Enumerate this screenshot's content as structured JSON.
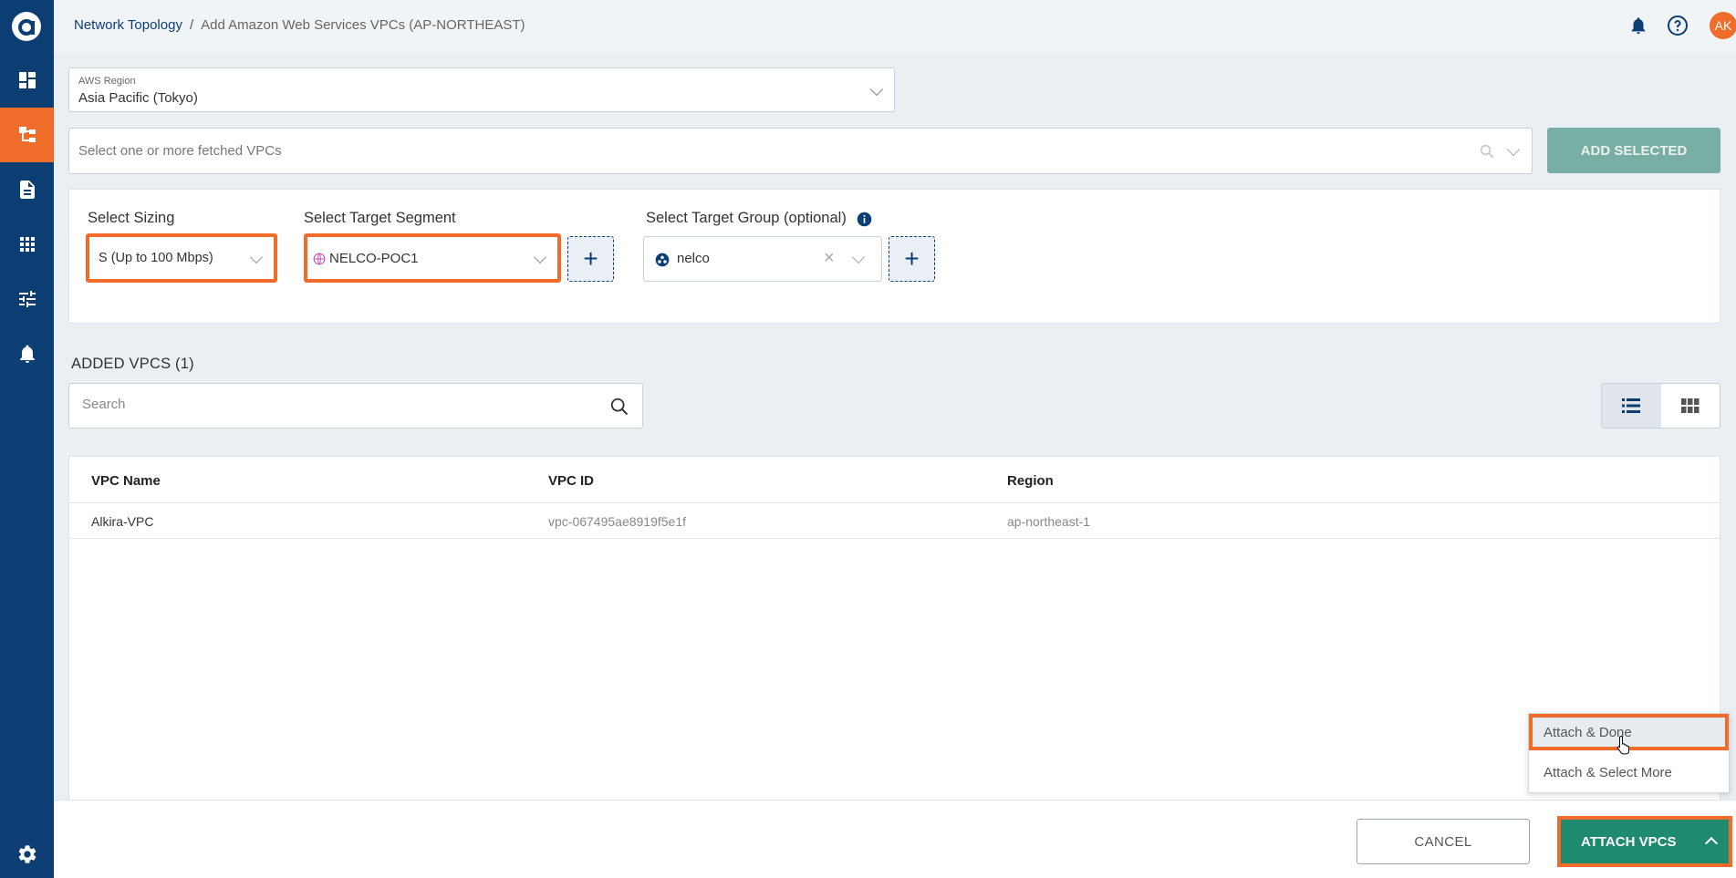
{
  "colors": {
    "sidebar": "#0c3d73",
    "accent_orange": "#ef6c2b",
    "primary_green": "#1f8a6e",
    "disabled_green": "#78aea3"
  },
  "sidebar": {
    "logo": "alkira-logo",
    "items": [
      {
        "icon": "dashboard-icon"
      },
      {
        "icon": "network-topology-icon",
        "active": true
      },
      {
        "icon": "document-icon"
      },
      {
        "icon": "apps-grid-icon"
      },
      {
        "icon": "sliders-icon"
      },
      {
        "icon": "bell-icon"
      },
      {
        "icon": "settings-gear-icon"
      }
    ]
  },
  "header": {
    "breadcrumb_root": "Network Topology",
    "breadcrumb_sep": "/",
    "breadcrumb_current": "Add Amazon Web Services VPCs (AP-NORTHEAST)",
    "avatar_initials": "AK"
  },
  "region": {
    "label": "AWS Region",
    "value": "Asia Pacific (Tokyo)"
  },
  "vpc_fetch": {
    "placeholder": "Select one or more fetched VPCs",
    "add_selected": "ADD SELECTED"
  },
  "config": {
    "sizing_title": "Select Sizing",
    "sizing_value": "S (Up to 100 Mbps)",
    "segment_title": "Select Target Segment",
    "segment_value": "NELCO-POC1",
    "group_title": "Select Target Group (optional)",
    "group_value": "nelco",
    "plus": "+"
  },
  "added": {
    "title": "ADDED VPCS (1)",
    "search_placeholder": "Search"
  },
  "table": {
    "columns": [
      "VPC Name",
      "VPC ID",
      "Region"
    ],
    "rows": [
      {
        "name": "Alkira-VPC",
        "id": "vpc-067495ae8919f5e1f",
        "region": "ap-northeast-1"
      }
    ]
  },
  "menu": {
    "items": [
      "Attach & Done",
      "Attach & Select More"
    ]
  },
  "footer": {
    "cancel": "CANCEL",
    "attach": "ATTACH VPCS"
  }
}
